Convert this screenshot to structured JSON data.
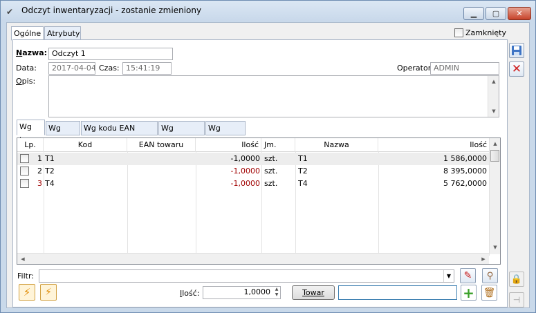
{
  "window": {
    "title": "Odczyt inwentaryzacji - zostanie zmieniony",
    "min_label": "▭",
    "max_label": "▢",
    "close_label": "✕"
  },
  "tabs": [
    {
      "label": "Ogólne",
      "active": true
    },
    {
      "label": "Atrybuty",
      "active": false
    }
  ],
  "closed_checkbox": {
    "label": "Zamknięty",
    "checked": false
  },
  "form": {
    "name_label": "Nazwa:",
    "name_value": "Odczyt 1",
    "date_label": "Data:",
    "date_value": "2017-04-04",
    "time_label": "Czas:",
    "time_value": "15:41:19",
    "operator_label": "Operator:",
    "operator_value": "ADMIN",
    "desc_label": "Opis:",
    "desc_value": ""
  },
  "sort_tabs": [
    {
      "label": "Wg lp.",
      "active": true
    },
    {
      "label": "Wg kodu",
      "active": false
    },
    {
      "label": "Wg kodu EAN towaru",
      "active": false
    },
    {
      "label": "Wg symbolu",
      "active": false
    },
    {
      "label": "Wg nazwy",
      "active": false
    }
  ],
  "table": {
    "columns": [
      "Lp.",
      "Kod",
      "EAN towaru",
      "Ilość",
      "Jm.",
      "Nazwa",
      "Ilość"
    ],
    "rows": [
      {
        "lp": "1",
        "kod": "T1",
        "ean": "",
        "ilosc1": "-1,0000",
        "jm": "szt.",
        "nazwa": "T1",
        "ilosc2": "1 586,0000"
      },
      {
        "lp": "2",
        "kod": "T2",
        "ean": "",
        "ilosc1": "-1,0000",
        "jm": "szt.",
        "nazwa": "T2",
        "ilosc2": "8 395,0000"
      },
      {
        "lp": "3",
        "kod": "T4",
        "ean": "",
        "ilosc1": "-1,0000",
        "jm": "szt.",
        "nazwa": "T4",
        "ilosc2": "5 762,0000"
      }
    ]
  },
  "filter": {
    "label": "Filtr:",
    "value": ""
  },
  "bottom": {
    "qty_label": "Ilość:",
    "qty_value": "1,0000",
    "towar_button": "Towar",
    "towar_input": ""
  },
  "colors": {
    "accent": "#1e6cc8",
    "negative": "#a00000",
    "add": "#3aa02a",
    "delete": "#d02020"
  }
}
